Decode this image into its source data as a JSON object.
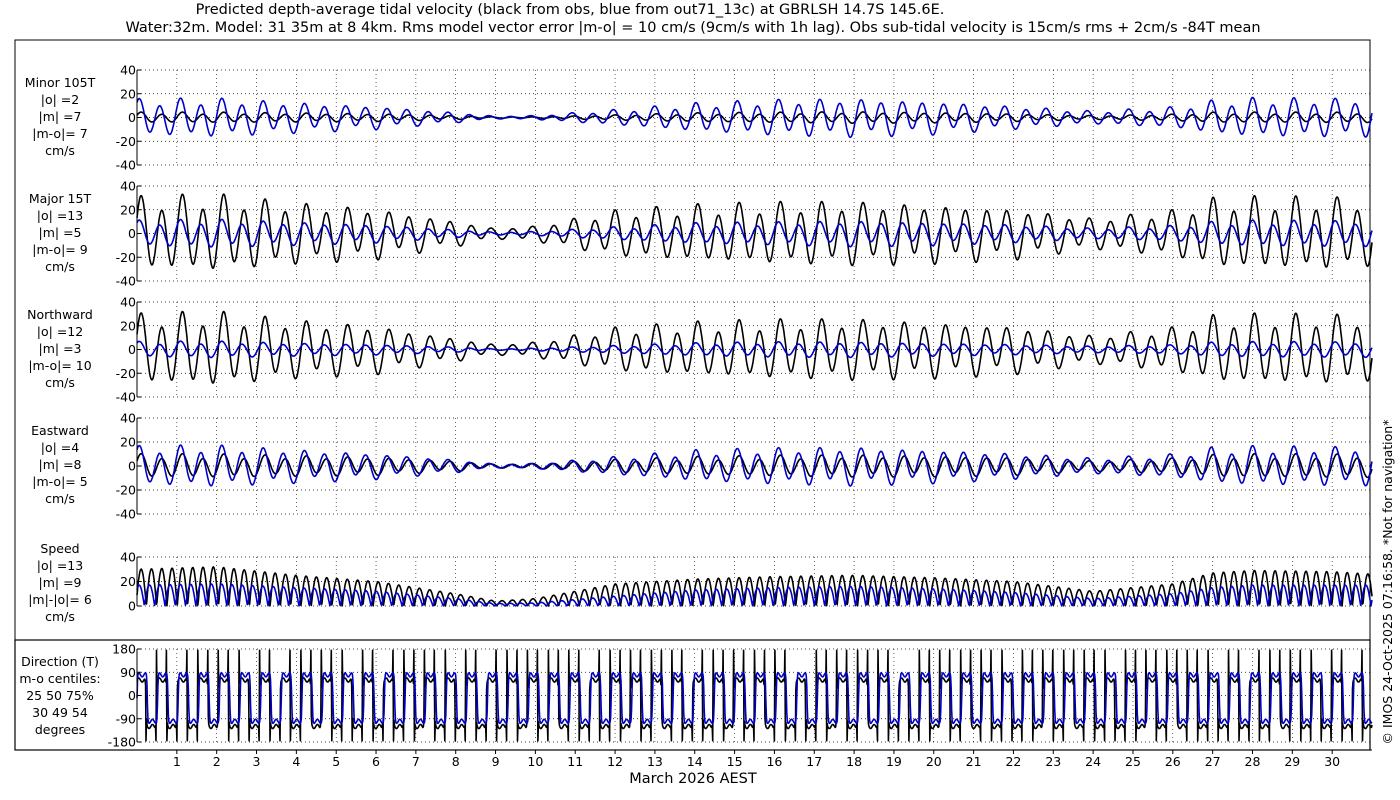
{
  "title_line1": "Predicted depth-average tidal velocity (black from obs, blue from out71_13c) at GBRLSH 14.7S 145.6E.",
  "title_line2": "Water:32m. Model: 31 35m at 8 4km. Rms model vector error |m-o| = 10 cm/s (9cm/s with 1h lag). Obs sub-tidal velocity is 15cm/s rms + 2cm/s -84T mean",
  "xlabel": "March 2026 AEST",
  "copyright": "© IMOS 24-Oct-2025 07:16:58. *Not for navigation*",
  "colors": {
    "obs": "#000000",
    "model": "#0000cc",
    "grid": "#000000"
  },
  "panels": [
    {
      "id": "minor",
      "label": [
        "Minor 105T",
        "|o| =2",
        "|m| =7",
        "|m-o|= 7",
        "cm/s"
      ],
      "ylim": [
        -40,
        40
      ],
      "yticks": [
        "-40",
        "-20",
        "0",
        "20",
        "40"
      ],
      "yvals": [
        -40,
        -20,
        0,
        20,
        40
      ]
    },
    {
      "id": "major",
      "label": [
        "Major 15T",
        "|o| =13",
        "|m| =5",
        "|m-o|= 9",
        "cm/s"
      ],
      "ylim": [
        -40,
        40
      ],
      "yticks": [
        "-40",
        "-20",
        "0",
        "20",
        "40"
      ],
      "yvals": [
        -40,
        -20,
        0,
        20,
        40
      ]
    },
    {
      "id": "northward",
      "label": [
        "Northward",
        "|o| =12",
        "|m| =3",
        "|m-o|= 10",
        "cm/s"
      ],
      "ylim": [
        -40,
        40
      ],
      "yticks": [
        "-40",
        "-20",
        "0",
        "20",
        "40"
      ],
      "yvals": [
        -40,
        -20,
        0,
        20,
        40
      ]
    },
    {
      "id": "eastward",
      "label": [
        "Eastward",
        "|o| =4",
        "|m| =8",
        "|m-o|= 5",
        "cm/s"
      ],
      "ylim": [
        -40,
        40
      ],
      "yticks": [
        "-40",
        "-20",
        "0",
        "20",
        "40"
      ],
      "yvals": [
        -40,
        -20,
        0,
        20,
        40
      ]
    },
    {
      "id": "speed",
      "label": [
        "Speed",
        "|o| =13",
        "|m| =9",
        "|m|-|o|= 6",
        "cm/s"
      ],
      "ylim": [
        0,
        40
      ],
      "yticks": [
        "0",
        "20",
        "40"
      ],
      "yvals": [
        0,
        20,
        40
      ]
    },
    {
      "id": "direction",
      "label": [
        "Direction (T)",
        "m-o centiles:",
        "25  50  75%",
        "30  49  54",
        "degrees"
      ],
      "ylim": [
        -180,
        180
      ],
      "yticks": [
        "-180",
        "-90",
        "0",
        "90",
        "180"
      ],
      "yvals": [
        -180,
        -90,
        0,
        90,
        180
      ]
    }
  ],
  "chart_data": {
    "type": "line",
    "x_unit": "day of March 2026 (AEST)",
    "xlim": [
      0,
      31
    ],
    "xticks": [
      1,
      2,
      3,
      4,
      5,
      6,
      7,
      8,
      9,
      10,
      11,
      12,
      13,
      14,
      15,
      16,
      17,
      18,
      19,
      20,
      21,
      22,
      23,
      24,
      25,
      26,
      27,
      28,
      29,
      30
    ],
    "xtick_labels": [
      "1",
      "2",
      "3",
      "4",
      "5",
      "6",
      "7",
      "8",
      "9",
      "10",
      "11",
      "12",
      "13",
      "14",
      "15",
      "16",
      "17",
      "18",
      "19",
      "20",
      "21",
      "22",
      "23",
      "24",
      "25",
      "26",
      "27",
      "28",
      "29",
      "30"
    ],
    "envelope_days": [
      0,
      2,
      4,
      6,
      8,
      9,
      10,
      12,
      14,
      16,
      18,
      20,
      22,
      24,
      26,
      27,
      28,
      30,
      31
    ],
    "series": [
      {
        "panel": "minor",
        "source": "obs",
        "amplitude": [
          4,
          4,
          3.5,
          3,
          1.5,
          0.5,
          0.5,
          2,
          3.5,
          4,
          4.5,
          4,
          3,
          1.5,
          2.5,
          4,
          4,
          4,
          4
        ]
      },
      {
        "panel": "minor",
        "source": "model",
        "amplitude": [
          14,
          15,
          12,
          9,
          4,
          1,
          1.5,
          6,
          11,
          14,
          15,
          13,
          9,
          5,
          8,
          13,
          15,
          15,
          15
        ]
      },
      {
        "panel": "major",
        "source": "obs",
        "amplitude": [
          28,
          30,
          24,
          20,
          10,
          4,
          6,
          18,
          22,
          24,
          25,
          23,
          20,
          12,
          18,
          27,
          28,
          28,
          26
        ]
      },
      {
        "panel": "major",
        "source": "model",
        "amplitude": [
          10,
          11,
          9,
          7,
          3,
          1,
          1.5,
          5,
          8,
          9,
          10,
          9,
          7,
          4,
          6,
          9,
          10,
          10,
          10
        ]
      },
      {
        "panel": "northward",
        "source": "obs",
        "amplitude": [
          27,
          29,
          23,
          19,
          9,
          4,
          6,
          17,
          21,
          23,
          24,
          22,
          19,
          11,
          17,
          26,
          27,
          27,
          25
        ]
      },
      {
        "panel": "northward",
        "source": "model",
        "amplitude": [
          6,
          6.5,
          5,
          4,
          2,
          0.5,
          1,
          3,
          5,
          6,
          6,
          5,
          4,
          2.5,
          3.5,
          5.5,
          6,
          6,
          6
        ]
      },
      {
        "panel": "eastward",
        "source": "obs",
        "amplitude": [
          9,
          9,
          8,
          7,
          4,
          1.5,
          2,
          5,
          7,
          8,
          8.5,
          8,
          7,
          4,
          6,
          8.5,
          9,
          9,
          9
        ]
      },
      {
        "panel": "eastward",
        "source": "model",
        "amplitude": [
          15,
          16,
          13,
          10,
          5,
          1.5,
          2,
          7,
          12,
          14,
          15,
          13,
          10,
          6,
          9,
          14,
          15,
          15,
          15
        ]
      },
      {
        "panel": "speed",
        "source": "obs",
        "amplitude": [
          30,
          32,
          25,
          20,
          10,
          4,
          6,
          18,
          22,
          24,
          25,
          23,
          20,
          12,
          18,
          27,
          29,
          28,
          26
        ]
      },
      {
        "panel": "speed",
        "source": "model",
        "amplitude": [
          17,
          18,
          15,
          12,
          6,
          2,
          2.5,
          8,
          13,
          15,
          16,
          14,
          11,
          6,
          10,
          15,
          17,
          17,
          17
        ]
      },
      {
        "panel": "direction",
        "source": "obs",
        "levels": [
          60,
          -120
        ]
      },
      {
        "panel": "direction",
        "source": "model",
        "levels": [
          80,
          -100
        ]
      }
    ]
  }
}
